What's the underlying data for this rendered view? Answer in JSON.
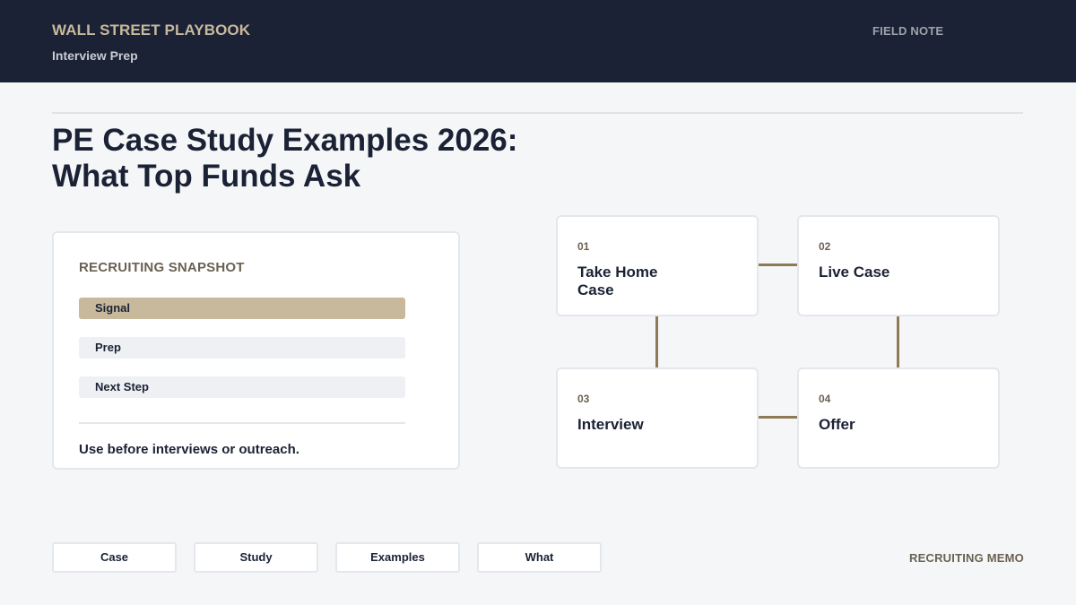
{
  "header": {
    "brand": "WALL STREET PLAYBOOK",
    "subtitle": "Interview Prep",
    "field_note": "FIELD NOTE"
  },
  "title": {
    "line1": "PE Case Study Examples 2026:",
    "line2": "What Top Funds Ask"
  },
  "snapshot": {
    "label": "RECRUITING SNAPSHOT",
    "items": [
      {
        "label": "Signal",
        "active": true
      },
      {
        "label": "Prep",
        "active": false
      },
      {
        "label": "Next Step",
        "active": false
      }
    ],
    "note": "Use before interviews or outreach."
  },
  "steps": [
    {
      "num": "01",
      "label": "Take Home Case"
    },
    {
      "num": "02",
      "label": "Live Case"
    },
    {
      "num": "03",
      "label": "Interview"
    },
    {
      "num": "04",
      "label": "Offer"
    }
  ],
  "tags": [
    "Case",
    "Study",
    "Examples",
    "What"
  ],
  "footer": {
    "memo": "RECRUITING MEMO"
  },
  "colors": {
    "navy": "#1b2235",
    "gold": "#c8b99c",
    "connector": "#8f7a56",
    "muted_brown": "#6b6153"
  }
}
